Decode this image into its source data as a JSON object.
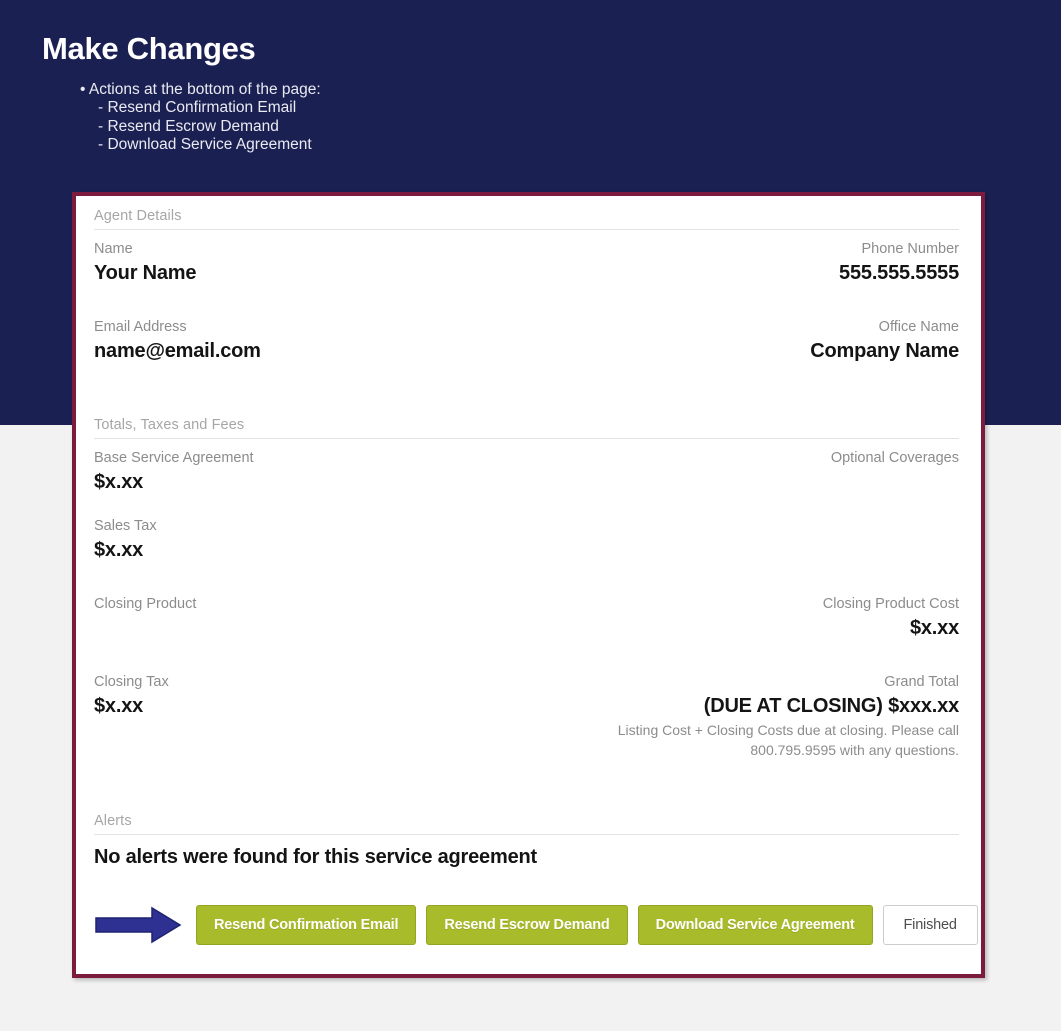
{
  "slide": {
    "title": "Make Changes",
    "bullets": [
      "• Actions at the bottom of the page:",
      "- Resend Confirmation Email",
      "- Resend Escrow Demand",
      "- Download Service Agreement"
    ],
    "bg_top_color": "#1b2052",
    "bg_bottom_color": "#f2f2f2",
    "panel_border_color": "#7c1b3d",
    "arrow_color": "#2e3192",
    "button_color": "#a8bb2b"
  },
  "panel": {
    "sections": {
      "agent_details": {
        "header": "Agent Details",
        "name_label": "Name",
        "name_value": "Your Name",
        "phone_label": "Phone Number",
        "phone_value": "555.555.5555",
        "email_label": "Email Address",
        "email_value": "name@email.com",
        "office_label": "Office Name",
        "office_value": "Company Name"
      },
      "totals": {
        "header": "Totals, Taxes and Fees",
        "base_label": "Base Service Agreement",
        "base_value": "$x.xx",
        "optional_label": "Optional Coverages",
        "optional_value": "",
        "sales_tax_label": "Sales Tax",
        "sales_tax_value": "$x.xx",
        "closing_product_label": "Closing Product",
        "closing_product_value": "",
        "closing_product_cost_label": "Closing Product Cost",
        "closing_product_cost_value": "$x.xx",
        "closing_tax_label": "Closing Tax",
        "closing_tax_value": "$x.xx",
        "grand_total_label": "Grand Total",
        "grand_total_value": "(DUE AT CLOSING) $xxx.xx",
        "grand_total_note_line1": "Listing Cost + Closing Costs due at closing. Please call",
        "grand_total_note_line2": "800.795.9595 with any questions."
      },
      "alerts": {
        "header": "Alerts",
        "message": "No alerts were found for this service agreement"
      }
    },
    "actions": {
      "resend_confirmation_email": "Resend Confirmation Email",
      "resend_escrow_demand": "Resend Escrow Demand",
      "download_service_agreement": "Download Service Agreement",
      "finished": "Finished"
    }
  }
}
